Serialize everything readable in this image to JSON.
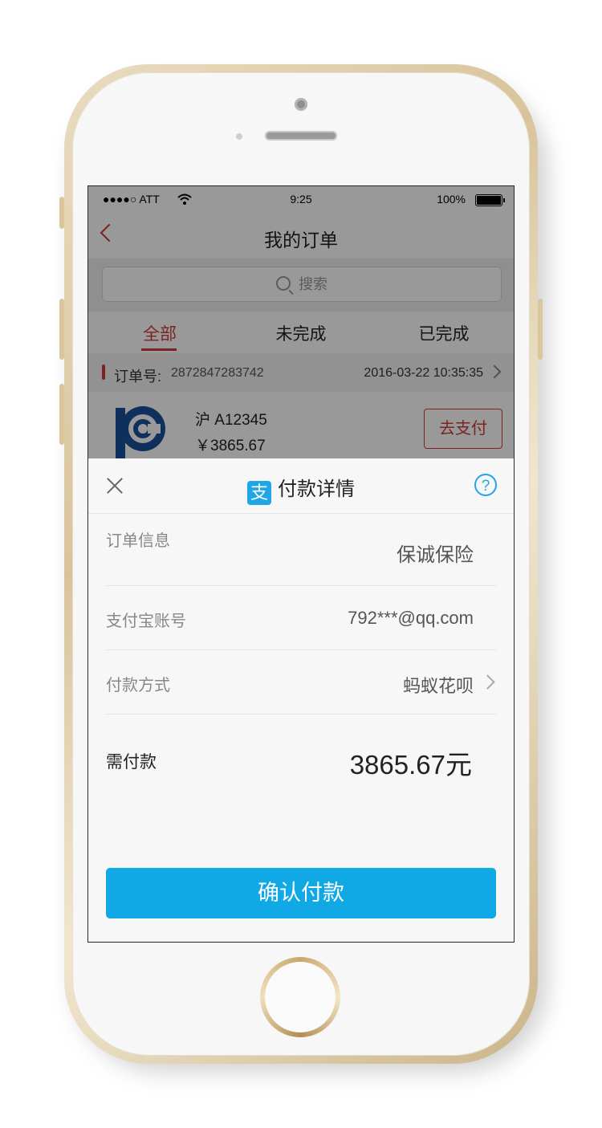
{
  "status_bar": {
    "carrier": "●●●●○ ATT",
    "time": "9:25",
    "battery": "100%"
  },
  "nav": {
    "title": "我的订单"
  },
  "search": {
    "placeholder": "搜索"
  },
  "tabs": [
    {
      "label": "全部",
      "active": true
    },
    {
      "label": "未完成",
      "active": false
    },
    {
      "label": "已完成",
      "active": false
    }
  ],
  "order": {
    "label": "订单号:",
    "number": "2872847283742",
    "datetime": "2016-03-22  10:35:35",
    "plate": "沪 A12345",
    "price": "￥3865.67",
    "pay_button": "去支付"
  },
  "payment_sheet": {
    "title": "付款详情",
    "order_info_label": "订单信息",
    "order_info_value": "保诚保险",
    "account_label": "支付宝账号",
    "account_value": "792***@qq.com",
    "method_label": "付款方式",
    "method_value": "蚂蚁花呗",
    "amount_label": "需付款",
    "amount_value": "3865.67元",
    "confirm_button": "确认付款"
  },
  "colors": {
    "accent_red": "#d03a3a",
    "alipay_blue": "#11a8e6"
  }
}
